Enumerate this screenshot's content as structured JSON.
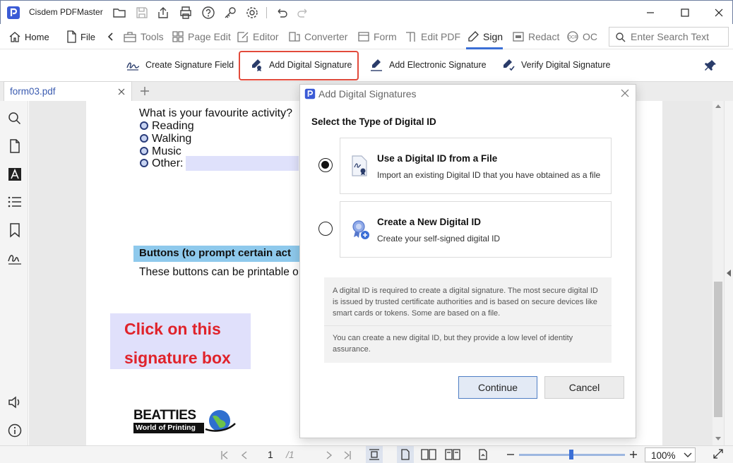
{
  "app": {
    "title": "Cisdem PDFMaster"
  },
  "menu": {
    "home": "Home",
    "file": "File",
    "tools": "Tools",
    "page_edit": "Page Edit",
    "editor": "Editor",
    "converter": "Converter",
    "form": "Form",
    "edit_pdf": "Edit PDF",
    "sign": "Sign",
    "redact": "Redact",
    "ocr": "OC",
    "search_placeholder": "Enter Search Text"
  },
  "sign_toolbar": {
    "create_field": "Create Signature Field",
    "add_digital": "Add Digital Signature",
    "add_electronic": "Add Electronic Signature",
    "verify": "Verify Digital Signature"
  },
  "tab": {
    "name": "form03.pdf"
  },
  "document": {
    "question": "What is your favourite activity?",
    "options": [
      "Reading",
      "Walking",
      "Music",
      "Other:"
    ],
    "buttons_heading": "Buttons (to prompt certain act",
    "buttons_text": "These buttons can be printable o",
    "sig_line1": "Click on this",
    "sig_line2": "signature box",
    "logo_line1": "BEATTIES",
    "logo_line2": "World of Printing"
  },
  "dialog": {
    "title": "Add Digital Signatures",
    "subtitle": "Select the Type of Digital ID",
    "option_file_title": "Use a Digital ID from a File",
    "option_file_desc": "Import an existing Digital ID that you have obtained as a file",
    "option_new_title": "Create a New Digital ID",
    "option_new_desc": "Create your self-signed digital ID",
    "info_1": "A digital ID is required to create a digital signature. The most secure digital ID is issued by trusted certificate authorities and is based on secure devices like smart cards or tokens. Some are based on a file.",
    "info_2": "You can create a new digital ID, but they provide a low level of identity assurance.",
    "continue": "Continue",
    "cancel": "Cancel"
  },
  "status": {
    "page_current": "1",
    "page_total": "/1",
    "zoom": "100%",
    "zoom_slider_fraction": 0.5
  },
  "colors": {
    "accent": "#3b6fd6",
    "highlight_border": "#e24a3b",
    "signature_text": "#e0232b"
  }
}
